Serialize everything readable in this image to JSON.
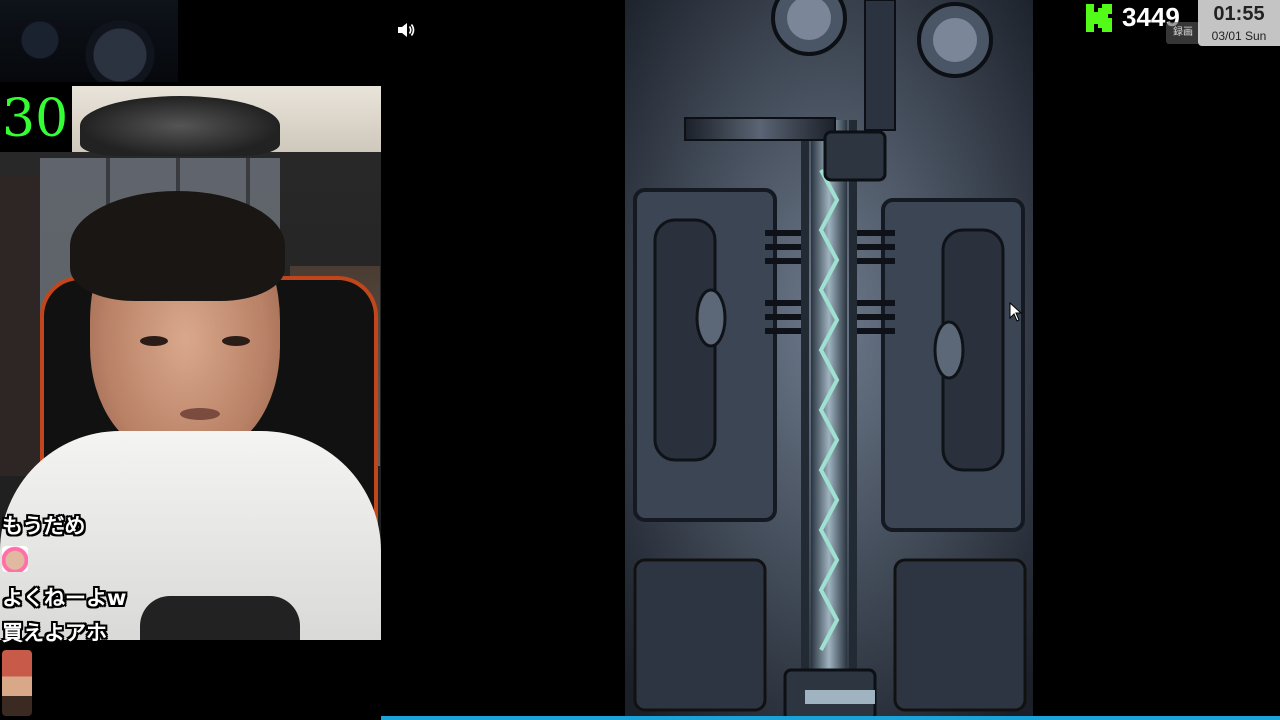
{
  "stream": {
    "countdown": "30",
    "viewer_count": "3449",
    "clock_time": "01:55",
    "clock_date": "03/01 Sun",
    "status_chip": "録画"
  },
  "comments": [
    {
      "text": "もうだめ",
      "avatar": "none"
    },
    {
      "text": "よくねーよw",
      "avatar": "sticker-avatar"
    },
    {
      "text": "買えよアホ",
      "avatar": "none"
    }
  ],
  "colors": {
    "timer": "#34ff34",
    "kick_green": "#53fc18",
    "chair_accent": "#c2461b",
    "progress": "#1aa3d9"
  },
  "icons": [
    "speaker-icon",
    "kick-logo-icon",
    "mouse-cursor-icon"
  ],
  "progress": {
    "fraction": 1.0
  }
}
